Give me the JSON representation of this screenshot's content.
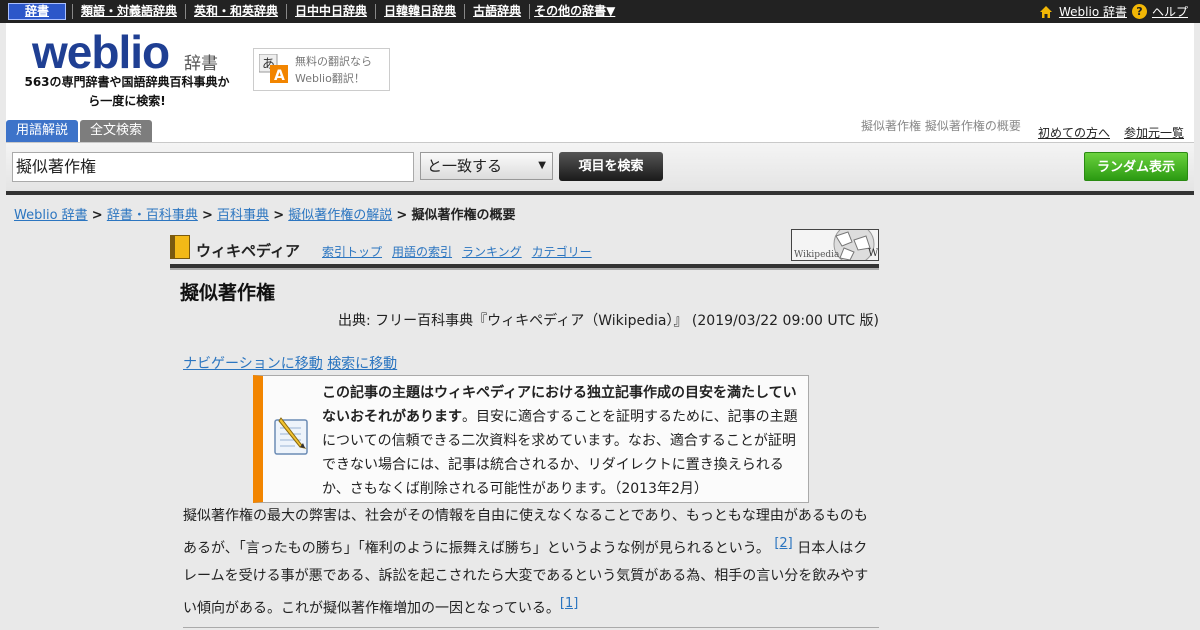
{
  "topnav": {
    "items": [
      "辞書",
      "類語・対義語辞典",
      "英和・和英辞典",
      "日中中日辞典",
      "日韓韓日辞典",
      "古語辞典",
      "その他の辞書▼"
    ],
    "home_link": "Weblio 辞書",
    "help_icon": "?",
    "help_link": "ヘルプ"
  },
  "header": {
    "logo": "weblio",
    "logo_sub": "辞書",
    "tagline": "563の専門辞書や国語辞典百科事典から一度に検索!",
    "translate_line1": "無料の翻訳なら",
    "translate_line2": "Weblio翻訳！",
    "tabs": [
      "用語解説",
      "全文検索"
    ],
    "right_title": "擬似著作権 擬似著作権の概要",
    "links": [
      "初めての方へ",
      "参加元一覧"
    ]
  },
  "search": {
    "value": "擬似著作権",
    "mode": "と一致する",
    "mode_arrow": "▼",
    "search_button": "項目を検索",
    "random_button": "ランダム表示"
  },
  "breadcrumb": {
    "items": [
      "Weblio 辞書",
      "辞書・百科事典",
      "百科事典",
      "擬似著作権の解説"
    ],
    "separator": ">",
    "current": "擬似著作権の概要"
  },
  "wiki": {
    "title": "ウィキペディア",
    "links": [
      "索引トップ",
      "用語の索引",
      "ランキング",
      "カテゴリー"
    ],
    "logo_text": "Wikipedia"
  },
  "article": {
    "title": "擬似著作権",
    "source": "出典: フリー百科事典『ウィキペディア（Wikipedia）』 (2019/03/22 09:00 UTC 版)",
    "nav_links": [
      "ナビゲーションに移動",
      "検索に移動"
    ],
    "notice_bold": "この記事の主題はウィキペディアにおける独立記事作成の目安を満たしていないおそれがあります",
    "notice_text": "。目安に適合することを証明するために、記事の主題についての信頼できる二次資料を求めています。なお、適合することが証明できない場合には、記事は統合されるか、リダイレクトに置き換えられるか、さもなくば削除される可能性があります。（2013年2月）",
    "body_part1": "擬似著作権の最大の弊害は、社会がその情報を自由に使えなくなることであり、もっともな理由があるものもあるが、「言ったもの勝ち」「権利のように振舞えば勝ち」というような例が見られるという。",
    "ref1": "[2]",
    "body_part2": " 日本人はクレームを受ける事が悪である、訴訟を起こされたら大変であるという気質がある為、相手の言い分を飲みやすい傾向がある。これが擬似著作権増加の一因となっている。",
    "ref2": "[1]"
  }
}
